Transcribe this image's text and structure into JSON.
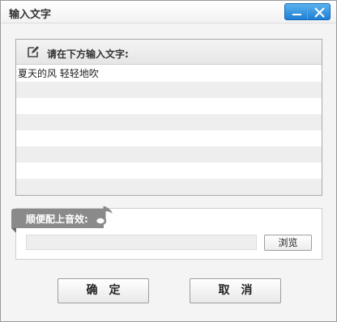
{
  "window": {
    "title": "输入文字",
    "buttons": {
      "minimize": "minimize-icon",
      "close": "close-icon"
    },
    "accent_color": "#2a8ade"
  },
  "input_panel": {
    "icon": "edit-icon",
    "label": "请在下方输入文字:",
    "text_value": "夏天的风 轻轻地吹"
  },
  "sound_section": {
    "label": "顺便配上音效:",
    "icon": "music-note-icon",
    "file_path_value": "",
    "browse_label": "浏览"
  },
  "actions": {
    "confirm_label": "确定",
    "cancel_label": "取消"
  }
}
